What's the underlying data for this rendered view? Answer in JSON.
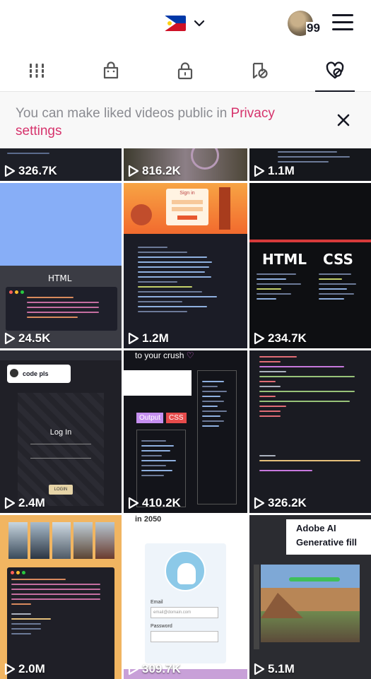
{
  "topbar": {
    "region_icon": "philippines-flag-icon",
    "avatar_badge": "99"
  },
  "tabs": [
    {
      "name": "videos-grid-icon",
      "active": false
    },
    {
      "name": "shop-bag-icon",
      "active": false
    },
    {
      "name": "private-lock-icon",
      "active": false
    },
    {
      "name": "reposts-icon",
      "active": false
    },
    {
      "name": "liked-videos-icon",
      "active": true
    }
  ],
  "notice": {
    "text": "You can make liked videos public in ",
    "link": "Privacy settings"
  },
  "videos": [
    {
      "views": "326.7K"
    },
    {
      "views": "816.2K"
    },
    {
      "views": "1.1M"
    },
    {
      "views": "24.5K",
      "label": "HTML"
    },
    {
      "views": "1.2M",
      "overlay": "Sign in"
    },
    {
      "views": "234.7K",
      "label_a": "HTML",
      "label_b": "CSS"
    },
    {
      "views": "2.4M",
      "comment": "code pls",
      "form_title": "Log In",
      "button": "LOGIN"
    },
    {
      "views": "410.2K",
      "caption": "to your crush",
      "output": "Output",
      "css": "CSS"
    },
    {
      "views": "326.2K"
    },
    {
      "views": "2.0M"
    },
    {
      "views": "309.7K",
      "caption": "in 2050",
      "email_label": "Email",
      "email_placeholder": "email@domain.com",
      "password_label": "Password"
    },
    {
      "views": "5.1M",
      "overlay_line1": "Adobe AI",
      "overlay_line2": "Generative fill"
    }
  ],
  "colors": {
    "accent": "#d6336c",
    "text_muted": "#8a8b91",
    "text_dark": "#161823"
  }
}
